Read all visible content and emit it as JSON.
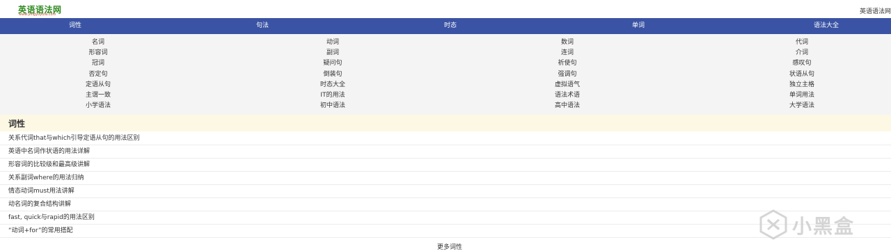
{
  "header": {
    "logo_text": "英语语法网",
    "logo_sub": "www.yingyuyufa.com",
    "site_name": "英语语法网"
  },
  "nav": {
    "items": [
      "词性",
      "句法",
      "时态",
      "单词",
      "语法大全"
    ]
  },
  "links": {
    "columns": [
      [
        "名词",
        "形容词",
        "冠词",
        "否定句",
        "定语从句",
        "主谓一致",
        "小学语法"
      ],
      [
        "动词",
        "副词",
        "疑问句",
        "倒装句",
        "时态大全",
        "IT的用法",
        "初中语法"
      ],
      [
        "数词",
        "连词",
        "祈使句",
        "强调句",
        "虚拟语气",
        "语法术语",
        "高中语法"
      ],
      [
        "代词",
        "介词",
        "感叹句",
        "状语从句",
        "独立主格",
        "单词用法",
        "大学语法"
      ]
    ]
  },
  "section": {
    "title": "词性",
    "articles": [
      "关系代词that与which引导定语从句的用法区别",
      "英语中名词作状语的用法详解",
      "形容词的比较级和最高级讲解",
      "关系副词where的用法归纳",
      "情态动词must用法讲解",
      "动名词的复合结构讲解",
      "fast, quick与rapid的用法区别",
      "“动词+for”的常用搭配"
    ],
    "more": "更多词性"
  },
  "watermark": {
    "text": "小黑盒"
  }
}
